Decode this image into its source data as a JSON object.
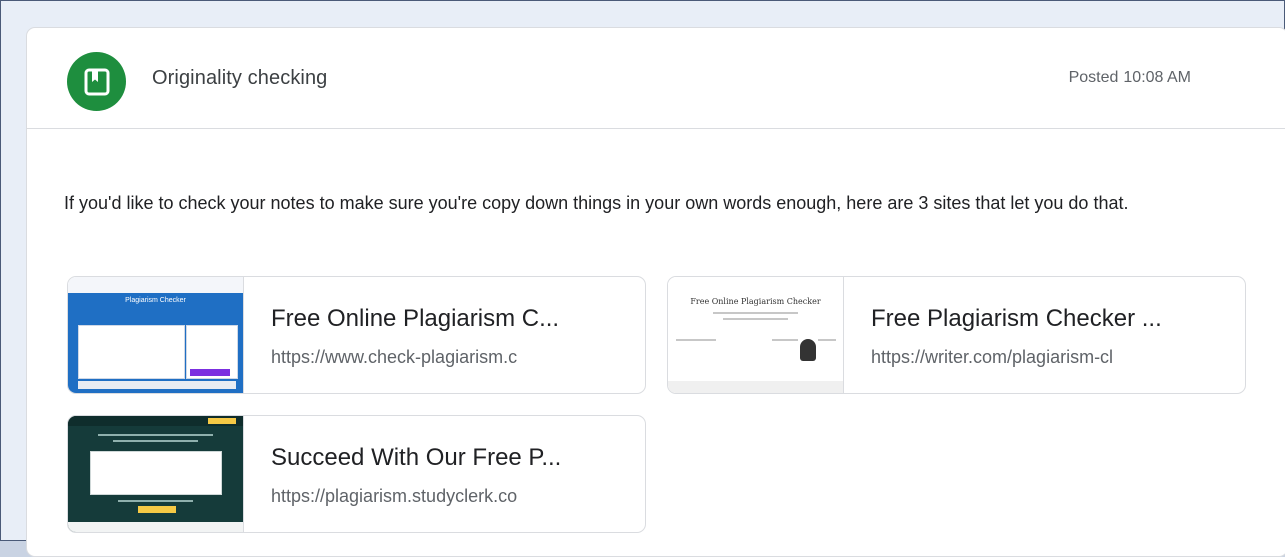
{
  "post": {
    "title": "Originality checking",
    "posted_label": "Posted",
    "posted_time": "10:08 AM",
    "icon": "bookmark-icon",
    "accent_color": "#1e8e3e",
    "body": "If you'd like to check your notes to make sure you're copy down things in your own words enough, here are 3 sites that let you do that."
  },
  "attachments": [
    {
      "title": "Free Online Plagiarism C...",
      "url": "https://www.check-plagiarism.c",
      "thumbnail_text": "Plagiarism Checker"
    },
    {
      "title": "Free Plagiarism Checker ...",
      "url": "https://writer.com/plagiarism-cl",
      "thumbnail_text": "Free Online Plagiarism Checker"
    },
    {
      "title": "Succeed With Our Free P...",
      "url": "https://plagiarism.studyclerk.co",
      "thumbnail_text": ""
    }
  ]
}
